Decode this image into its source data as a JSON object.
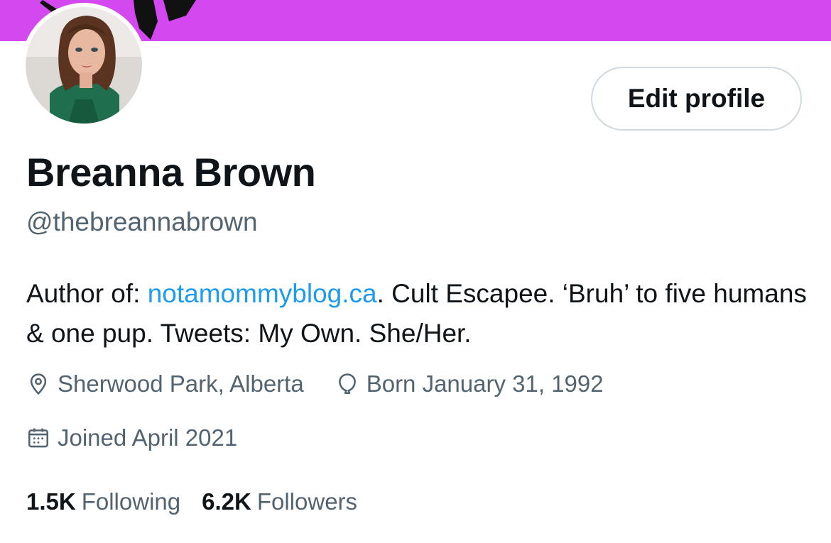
{
  "profile": {
    "display_name": "Breanna Brown",
    "handle": "@thebreannabrown",
    "edit_button_label": "Edit profile",
    "bio": {
      "prefix": "Author of: ",
      "link_text": "notamommyblog.ca",
      "suffix": ". Cult Escapee. ‘Bruh’ to five humans & one pup. Tweets: My Own. She/Her."
    },
    "location": "Sherwood Park, Alberta",
    "birthday": "Born January 31, 1992",
    "joined": "Joined April 2021",
    "stats": {
      "following_count": "1.5K",
      "following_label": "Following",
      "followers_count": "6.2K",
      "followers_label": "Followers"
    }
  },
  "icons": {
    "location": "location-pin-icon",
    "birthday": "balloon-icon",
    "joined": "calendar-icon"
  },
  "colors": {
    "banner": "#d448f0",
    "link": "#1d9bf0",
    "secondary_text": "#536471",
    "primary_text": "#0f1419"
  }
}
